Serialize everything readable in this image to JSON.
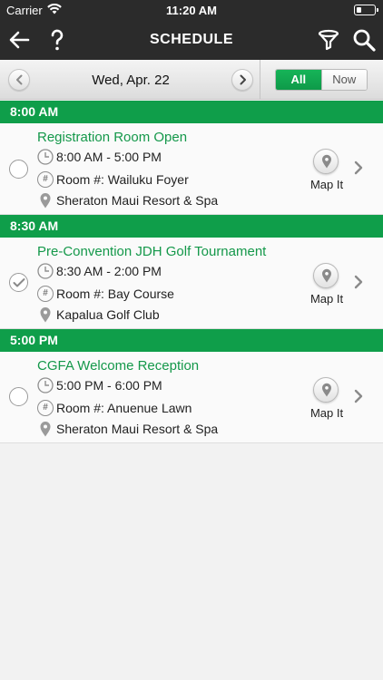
{
  "status_bar": {
    "carrier": "Carrier",
    "time": "11:20 AM"
  },
  "nav": {
    "title": "SCHEDULE",
    "icons": [
      "back-arrow-icon",
      "help-icon",
      "filter-icon",
      "search-icon"
    ]
  },
  "date_bar": {
    "date": "Wed, Apr. 22",
    "segments": {
      "all": "All",
      "now": "Now",
      "selected": "All"
    }
  },
  "colors": {
    "accent": "#0f9e4a",
    "title_text": "#14984a",
    "nav_bg": "#2b2b2b"
  },
  "sections": [
    {
      "time": "8:00 AM",
      "event": {
        "title": "Registration Room Open",
        "time_range": "8:00 AM - 5:00 PM",
        "room": "Room #: Wailuku Foyer",
        "location": "Sheraton Maui Resort & Spa",
        "checked": false,
        "map_label": "Map It"
      }
    },
    {
      "time": "8:30 AM",
      "event": {
        "title": "Pre-Convention JDH Golf Tournament",
        "time_range": "8:30 AM - 2:00 PM",
        "room": "Room #: Bay Course",
        "location": "Kapalua Golf Club",
        "checked": true,
        "map_label": "Map It"
      }
    },
    {
      "time": "5:00 PM",
      "event": {
        "title": "CGFA Welcome Reception",
        "time_range": "5:00 PM - 6:00 PM",
        "room": "Room #: Anuenue Lawn",
        "location": "Sheraton Maui Resort & Spa",
        "checked": false,
        "map_label": "Map It"
      }
    }
  ]
}
